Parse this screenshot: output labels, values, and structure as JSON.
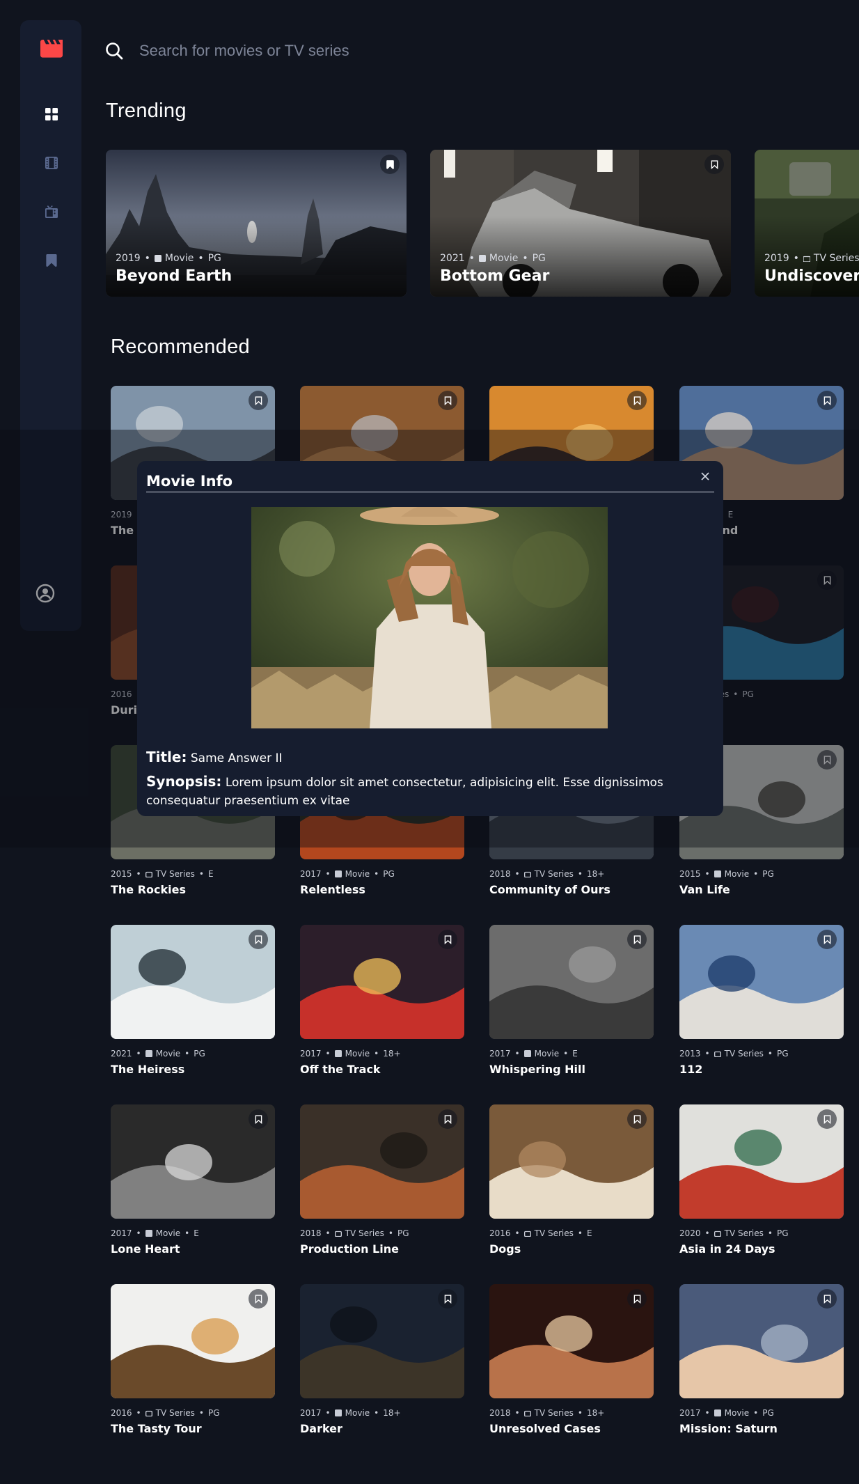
{
  "search": {
    "placeholder": "Search for movies or TV series"
  },
  "sections": {
    "trending": "Trending",
    "recommended": "Recommended"
  },
  "trending": [
    {
      "year": "2019",
      "category": "Movie",
      "rating": "PG",
      "title": "Beyond Earth"
    },
    {
      "year": "2021",
      "category": "Movie",
      "rating": "PG",
      "title": "Bottom Gear"
    },
    {
      "year": "2019",
      "category": "TV Series",
      "rating": "",
      "title": "Undiscovered"
    }
  ],
  "recommended": [
    {
      "year": "2019",
      "category": "",
      "rating": "",
      "title": "The C"
    },
    {
      "year": "",
      "category": "",
      "rating": "",
      "title": ""
    },
    {
      "year": "",
      "category": "",
      "rating": "",
      "title": ""
    },
    {
      "year": "",
      "category": "Movie",
      "rating": "E",
      "title": "d Beyond"
    },
    {
      "year": "2016",
      "category": "",
      "rating": "",
      "title": "Durin"
    },
    {
      "year": "",
      "category": "",
      "rating": "",
      "title": ""
    },
    {
      "year": "",
      "category": "",
      "rating": "",
      "title": ""
    },
    {
      "year": "",
      "category": "TV Series",
      "rating": "PG",
      "title": "cho"
    },
    {
      "year": "2015",
      "category": "TV Series",
      "rating": "E",
      "title": "The Rockies"
    },
    {
      "year": "2017",
      "category": "Movie",
      "rating": "PG",
      "title": "Relentless"
    },
    {
      "year": "2018",
      "category": "TV Series",
      "rating": "18+",
      "title": "Community of Ours"
    },
    {
      "year": "2015",
      "category": "Movie",
      "rating": "PG",
      "title": "Van Life"
    },
    {
      "year": "2021",
      "category": "Movie",
      "rating": "PG",
      "title": "The Heiress"
    },
    {
      "year": "2017",
      "category": "Movie",
      "rating": "18+",
      "title": "Off the Track"
    },
    {
      "year": "2017",
      "category": "Movie",
      "rating": "E",
      "title": "Whispering Hill"
    },
    {
      "year": "2013",
      "category": "TV Series",
      "rating": "PG",
      "title": "112"
    },
    {
      "year": "2017",
      "category": "Movie",
      "rating": "E",
      "title": "Lone Heart"
    },
    {
      "year": "2018",
      "category": "TV Series",
      "rating": "PG",
      "title": "Production Line"
    },
    {
      "year": "2016",
      "category": "TV Series",
      "rating": "E",
      "title": "Dogs"
    },
    {
      "year": "2020",
      "category": "TV Series",
      "rating": "PG",
      "title": "Asia in 24 Days"
    },
    {
      "year": "2016",
      "category": "TV Series",
      "rating": "PG",
      "title": "The Tasty Tour"
    },
    {
      "year": "2017",
      "category": "Movie",
      "rating": "18+",
      "title": "Darker"
    },
    {
      "year": "2018",
      "category": "TV Series",
      "rating": "18+",
      "title": "Unresolved Cases"
    },
    {
      "year": "2017",
      "category": "Movie",
      "rating": "PG",
      "title": "Mission: Saturn"
    }
  ],
  "modal": {
    "header": "Movie Info",
    "title_label": "Title:",
    "title_value": "Same Answer II",
    "synopsis_label": "Synopsis:",
    "synopsis_value": "Lorem ipsum dolor sit amet consectetur, adipisicing elit. Esse dignissimos consequatur praesentium ex vitae"
  },
  "colors": {
    "background": "#10141e",
    "surface": "#161d2f",
    "accent": "#fc4747",
    "muted": "#5a698f"
  },
  "icons": {
    "logo": "clapperboard-icon",
    "home": "grid-icon",
    "movies": "film-icon",
    "tv": "tv-icon",
    "bookmarks": "bookmark-icon",
    "profile": "avatar-icon",
    "search": "search-icon",
    "close": "close-icon"
  }
}
